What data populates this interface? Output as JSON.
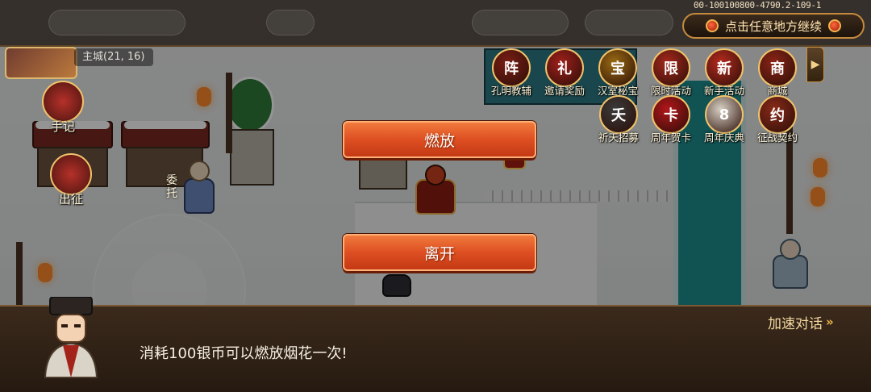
{
  "top_bar": {
    "version": "00-100100800-4790.2-109-1",
    "continue_label": "点击任意地方继续"
  },
  "map": {
    "location": "主城(21, 16)"
  },
  "activities": [
    {
      "label": "孔明教辅",
      "color": "#7a1e14",
      "glyph": "阵"
    },
    {
      "label": "邀请奖励",
      "color": "#a01f1a",
      "glyph": "礼"
    },
    {
      "label": "汉室秘宝",
      "color": "#9a6a12",
      "glyph": "宝"
    },
    {
      "label": "限时活动",
      "color": "#a5281c",
      "glyph": "限"
    },
    {
      "label": "新手活动",
      "color": "#b52a1e",
      "glyph": "新"
    },
    {
      "label": "商城",
      "color": "#8c2416",
      "glyph": "商"
    },
    {
      "label": "祈天招募",
      "color": "#3a3a3a",
      "glyph": "夭"
    },
    {
      "label": "周年贺卡",
      "color": "#b3161a",
      "glyph": "卡"
    },
    {
      "label": "周年庆典",
      "color": "#d8d0c4",
      "glyph": "8"
    },
    {
      "label": "征战契约",
      "color": "#8a2a18",
      "glyph": "约"
    }
  ],
  "side_actions": [
    {
      "label": "手记"
    },
    {
      "label": "出征"
    }
  ],
  "npc": {
    "label": "委托"
  },
  "options": {
    "fireworks": "燃放",
    "leave": "离开"
  },
  "dialog": {
    "text": "消耗100银币可以燃放烟花一次!",
    "speed_label": "加速对话"
  },
  "colors": {
    "accent_orange": "#de4f22",
    "dialog_bg": "#2f2116",
    "gold_border": "#c58a3d"
  }
}
